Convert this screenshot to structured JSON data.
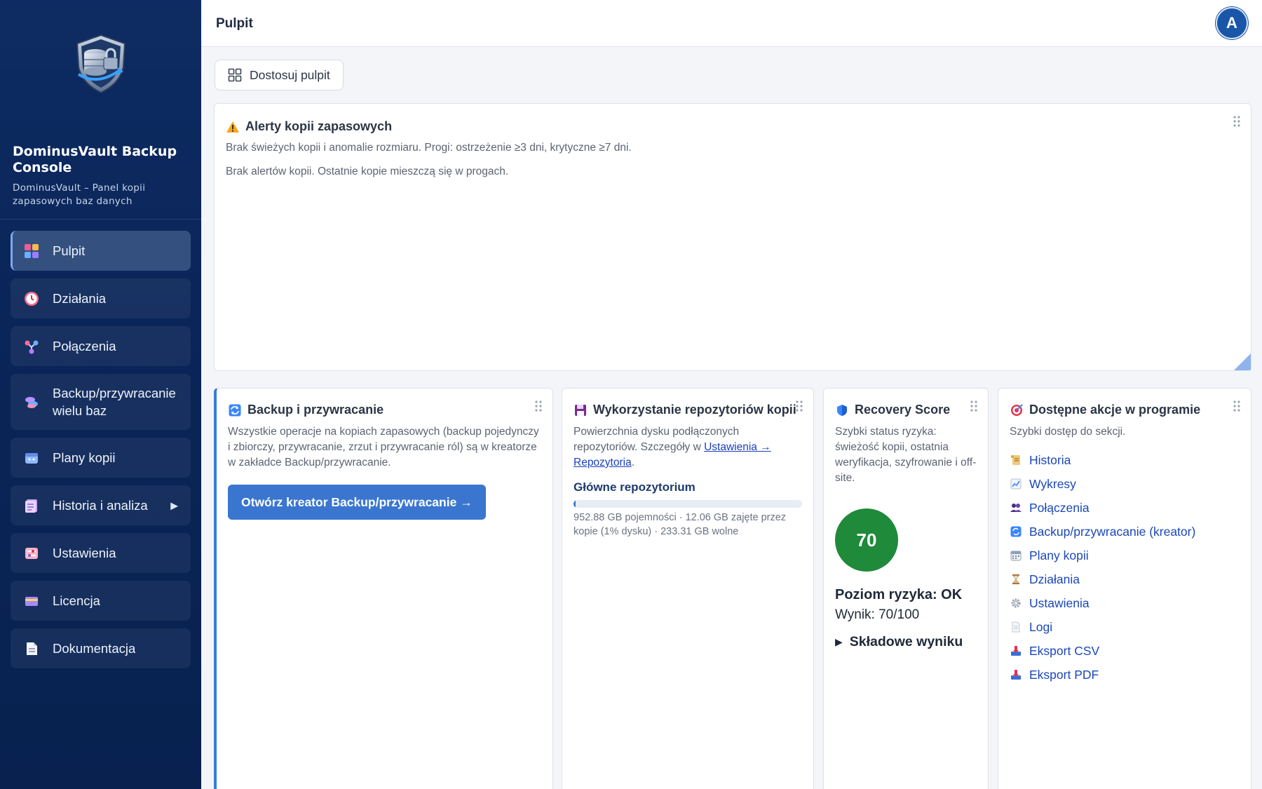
{
  "sidebar": {
    "brand_title": "DominusVault Backup Console",
    "brand_subtitle": "DominusVault – Panel kopii zapasowych baz danych",
    "items": [
      {
        "label": "Pulpit",
        "icon": "dashboard-icon"
      },
      {
        "label": "Działania",
        "icon": "clock-icon"
      },
      {
        "label": "Połączenia",
        "icon": "connections-icon"
      },
      {
        "label": "Backup/przywracanie wielu baz",
        "icon": "database-icon"
      },
      {
        "label": "Plany kopii",
        "icon": "calendar-icon"
      },
      {
        "label": "Historia i analiza",
        "icon": "history-icon",
        "arrow": "▶"
      },
      {
        "label": "Ustawienia",
        "icon": "settings-icon"
      },
      {
        "label": "Licencja",
        "icon": "license-card-icon"
      },
      {
        "label": "Dokumentacja",
        "icon": "document-icon"
      }
    ]
  },
  "topbar": {
    "title": "Pulpit",
    "avatar_letter": "A"
  },
  "customize": {
    "label": "Dostosuj pulpit"
  },
  "alerts": {
    "title": "Alerty kopii zapasowych",
    "description": "Brak świeżych kopii i anomalie rozmiaru. Progi: ostrzeżenie ≥3 dni, krytyczne ≥7 dni.",
    "status": "Brak alertów kopii. Ostatnie kopie mieszczą się w progach."
  },
  "backup_card": {
    "title": "Backup i przywracanie",
    "description": "Wszystkie operacje na kopiach zapasowych (backup pojedynczy i zbiorczy, przywracanie, zrzut i przywracanie ról) są w kreatorze w zakładce Backup/przywracanie.",
    "button": "Otwórz kreator Backup/przywracanie →"
  },
  "repo_card": {
    "title": "Wykorzystanie repozytoriów kopii",
    "desc_prefix": "Powierzchnia dysku podłączonych repozytoriów. Szczegóły w ",
    "desc_link": "Ustawienia → Repozytoria",
    "desc_suffix": ".",
    "repo_name": "Główne repozytorium",
    "used_fraction": 0.01,
    "stats": "952.88 GB pojemności · 12.06 GB zajęte przez kopie (1% dysku) · 233.31 GB wolne"
  },
  "score_card": {
    "title": "Recovery Score",
    "description": "Szybki status ryzyka: świeżość kopii, ostatnia weryfikacja, szyfrowanie i off-site.",
    "score": "70",
    "risk": "Poziom ryzyka: OK",
    "result": "Wynik: 70/100",
    "components": "Składowe wyniku",
    "color": "#1e8a3a"
  },
  "actions_card": {
    "title": "Dostępne akcje w programie",
    "description": "Szybki dostęp do sekcji.",
    "items": [
      {
        "label": "Historia",
        "icon": "scroll-icon"
      },
      {
        "label": "Wykresy",
        "icon": "chart-icon"
      },
      {
        "label": "Połączenia",
        "icon": "users-icon"
      },
      {
        "label": "Backup/przywracanie (kreator)",
        "icon": "sync-icon"
      },
      {
        "label": "Plany kopii",
        "icon": "calendar-icon"
      },
      {
        "label": "Działania",
        "icon": "hourglass-icon"
      },
      {
        "label": "Ustawienia",
        "icon": "gear-icon"
      },
      {
        "label": "Logi",
        "icon": "page-icon"
      },
      {
        "label": "Eksport CSV",
        "icon": "export-icon"
      },
      {
        "label": "Eksport PDF",
        "icon": "export-icon"
      }
    ]
  },
  "colors": {
    "sidebar": "#0a2558",
    "accent": "#3a76d0",
    "score_ok": "#1e8a3a"
  }
}
